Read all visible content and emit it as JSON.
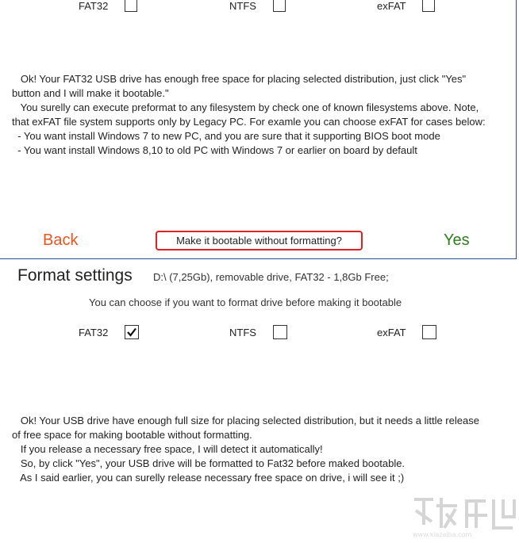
{
  "top_section": {
    "filesystems": [
      {
        "label": "FAT32",
        "checked": false
      },
      {
        "label": "NTFS",
        "checked": false
      },
      {
        "label": "exFAT",
        "checked": false
      }
    ],
    "message_lines": [
      "   Ok! Your FAT32 USB drive has enough free space for placing selected distribution, just click \"Yes\"",
      "button and I will make it bootable.\"",
      "   You surelly can execute preformat to any filesystem by check one of known filesystems above. Note,",
      "that exFAT file system supports only by Legacy PC. For examle you can choose exFAT for cases below:",
      "  - You want install Windows 7 to new PC, and you are sure that it supporting BIOS boot mode",
      "  - You want install Windows 8,10 to old PC with Windows 7 or earlier on board by default"
    ],
    "back_label": "Back",
    "make_bootable_label": "Make it bootable without formatting?",
    "yes_label": "Yes"
  },
  "bottom_section": {
    "heading": "Format settings",
    "drive_info": "D:\\ (7,25Gb), removable drive, FAT32 - 1,8Gb Free;",
    "hint": "You can choose if you want to format drive before making it bootable",
    "filesystems": [
      {
        "label": "FAT32",
        "checked": true
      },
      {
        "label": "NTFS",
        "checked": false
      },
      {
        "label": "exFAT",
        "checked": false
      }
    ],
    "message_lines": [
      "   Ok! Your USB drive have enough full size for placing selected distribution, but it needs a little release",
      "of free space for making bootable without formatting.",
      "   If you release a necessary free space, I will detect it automatically!",
      "   So, by click \"Yes\", your USB drive will be formatted to Fat32 before maked bootable.",
      "   As I said earlier, you can surelly release necessary free space on drive, i will see it ;)"
    ]
  },
  "watermark": {
    "text": "www.xiazaiba.com"
  },
  "colors": {
    "back": "#e8561e",
    "yes": "#2f7d20",
    "highlight": "#dd2222",
    "divider": "#2f4f8f"
  }
}
